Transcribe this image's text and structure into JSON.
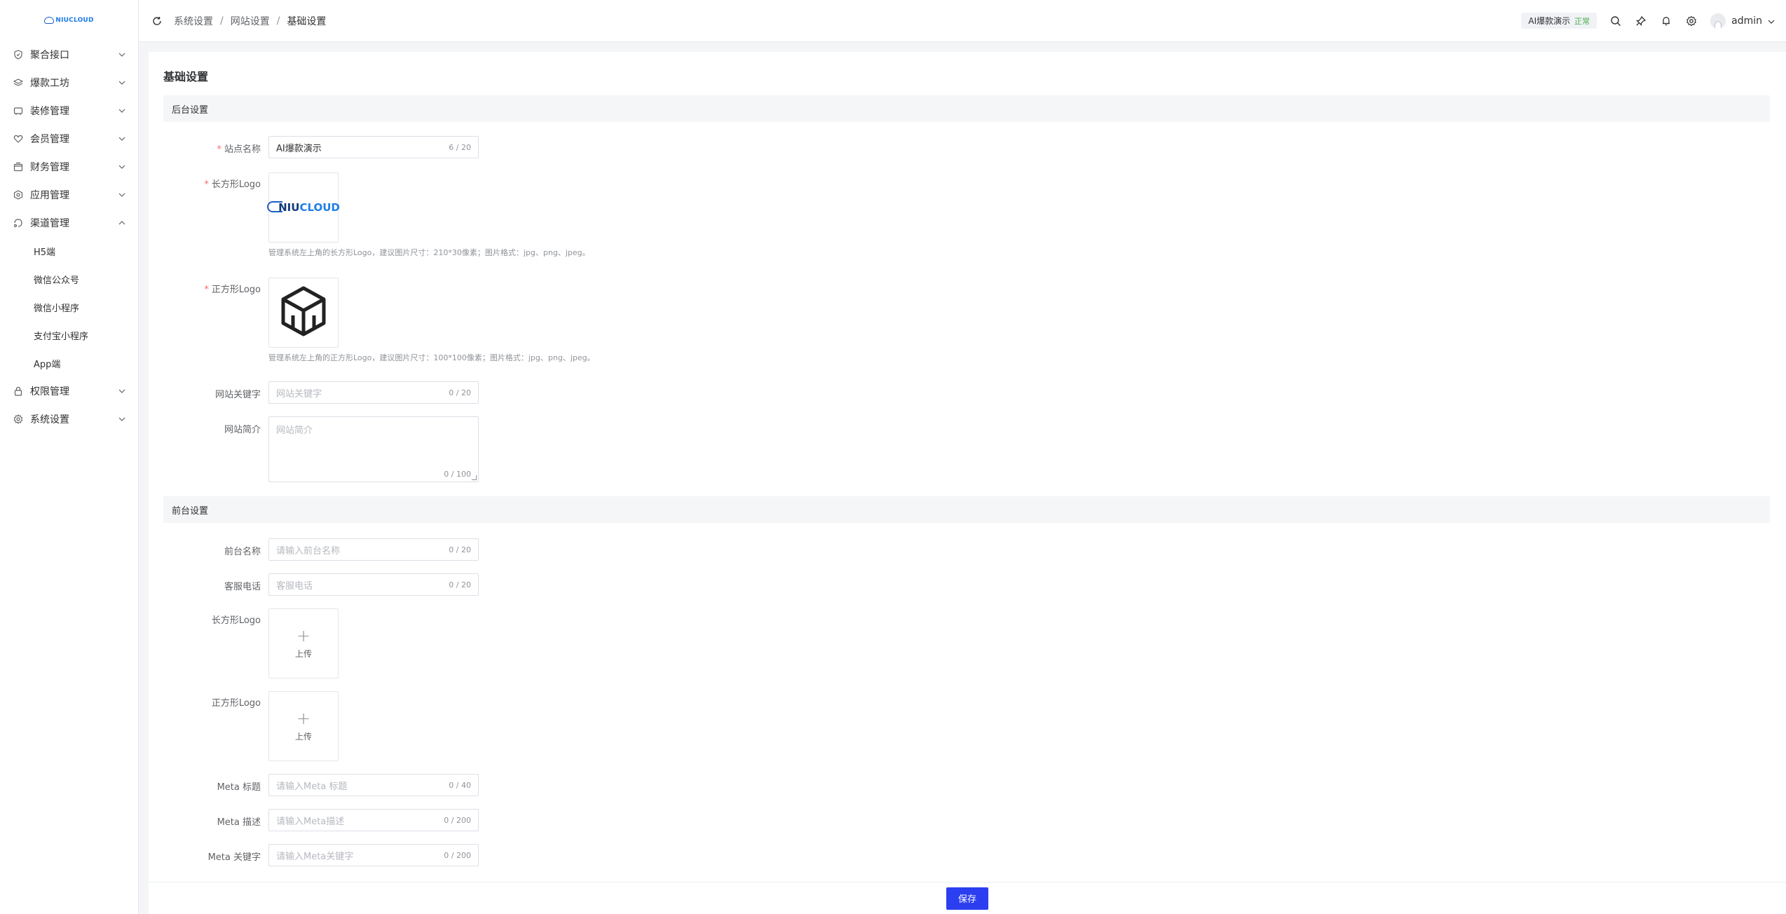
{
  "sidebar": {
    "logo_text": "NIUCLOUD",
    "items": [
      {
        "label": "聚合接口",
        "icon": "shield-icon"
      },
      {
        "label": "爆款工坊",
        "icon": "layers-icon"
      },
      {
        "label": "装修管理",
        "icon": "palette-icon"
      },
      {
        "label": "会员管理",
        "icon": "heart-icon"
      },
      {
        "label": "财务管理",
        "icon": "wallet-icon"
      },
      {
        "label": "应用管理",
        "icon": "hexagon-icon"
      },
      {
        "label": "渠道管理",
        "icon": "channel-icon",
        "expanded": true,
        "children": [
          "H5端",
          "微信公众号",
          "微信小程序",
          "支付宝小程序",
          "App端"
        ]
      },
      {
        "label": "权限管理",
        "icon": "lock-icon"
      },
      {
        "label": "系统设置",
        "icon": "gear-icon"
      }
    ]
  },
  "header": {
    "breadcrumb": [
      "系统设置",
      "网站设置",
      "基础设置"
    ],
    "site_name": "AI爆款演示",
    "site_status": "正常",
    "username": "admin"
  },
  "page": {
    "title": "基础设置",
    "backend_section": "后台设置",
    "frontend_section": "前台设置"
  },
  "backend": {
    "site_name": {
      "label": "站点名称",
      "value": "AI爆款演示",
      "count": "6 / 20"
    },
    "rect_logo": {
      "label": "长方形Logo",
      "logo_text_1": "NIU",
      "logo_text_2": "CLOUD",
      "hint": "管理系统左上角的长方形Logo，建议图片尺寸：210*30像素；图片格式：jpg、png、jpeg。"
    },
    "square_logo": {
      "label": "正方形Logo",
      "hint": "管理系统左上角的正方形Logo，建议图片尺寸：100*100像素；图片格式：jpg、png、jpeg。"
    },
    "keywords": {
      "label": "网站关键字",
      "placeholder": "网站关键字",
      "count": "0 / 20"
    },
    "description": {
      "label": "网站简介",
      "placeholder": "网站简介",
      "count": "0 / 100"
    }
  },
  "frontend": {
    "name": {
      "label": "前台名称",
      "placeholder": "请输入前台名称",
      "count": "0 / 20"
    },
    "phone": {
      "label": "客服电话",
      "placeholder": "客服电话",
      "count": "0 / 20"
    },
    "rect_logo": {
      "label": "长方形Logo",
      "upload": "上传"
    },
    "square_logo": {
      "label": "正方形Logo",
      "upload": "上传"
    },
    "meta_title": {
      "label": "Meta 标题",
      "placeholder": "请输入Meta 标题",
      "count": "0 / 40"
    },
    "meta_desc": {
      "label": "Meta 描述",
      "placeholder": "请输入Meta描述",
      "count": "0 / 200"
    },
    "meta_keywords": {
      "label": "Meta 关键字",
      "placeholder": "请输入Meta关键字",
      "count": "0 / 200"
    }
  },
  "footer": {
    "save_label": "保存"
  },
  "colors": {
    "primary": "#2c3ff0",
    "required": "#f56c6c",
    "status_ok": "#4caf50"
  }
}
